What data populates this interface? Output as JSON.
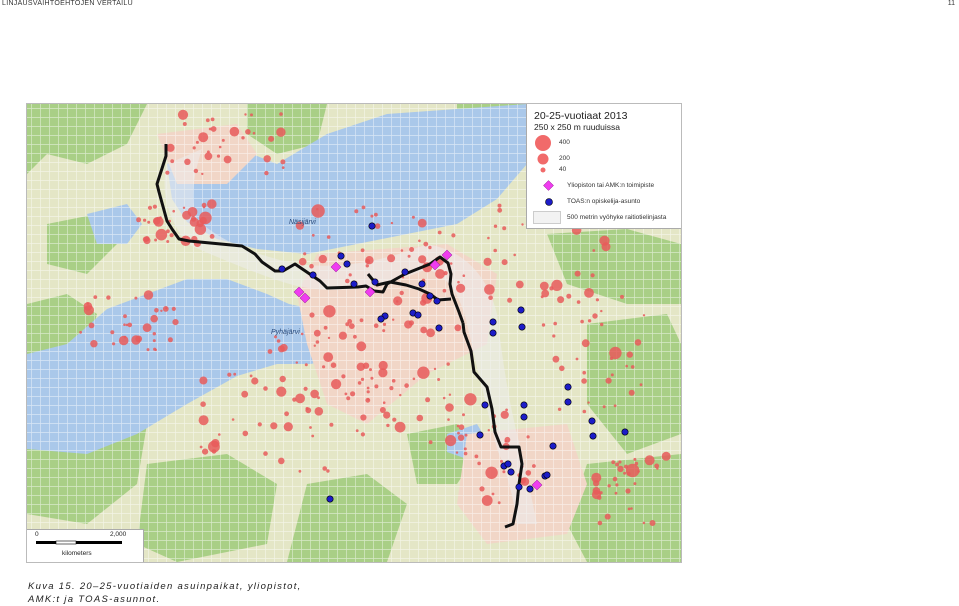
{
  "page": {
    "header_title": "LINJAUSVAIHTOEHTOJEN VERTAILU",
    "page_number": "11",
    "caption": "Kuva 15. 20–25-vuotiaiden asuinpaikat, yliopistot, AMK:t ja TOAS-asunnot."
  },
  "map": {
    "lake_labels": [
      "Näsijärvi",
      "Pyhäjärvi"
    ],
    "colors": {
      "land": "#e4e6c6",
      "forest": "#a9cf86",
      "water": "#aac8ea",
      "urban": "#f1d6c7",
      "population_dot": "#e85a5a",
      "route_line": "#111111",
      "university_marker": "#f03cf0",
      "toas_marker": "#1c1cc8"
    }
  },
  "legend": {
    "title": "20-25-vuotiaat 2013",
    "subtitle": "250 x 250 m ruuduissa",
    "sizes": [
      "400",
      "200",
      "40"
    ],
    "university_label": "Yliopiston tai AMK:n toimipiste",
    "toas_label": "TOAS:n opiskelija-asunto",
    "zone_label": "500 metrin vyöhyke raitiotielinjasta",
    "university_icon": "magenta-diamond",
    "toas_icon": "blue-circle"
  },
  "scalebar": {
    "start": "0",
    "end": "2,000",
    "unit": "kilometers"
  }
}
